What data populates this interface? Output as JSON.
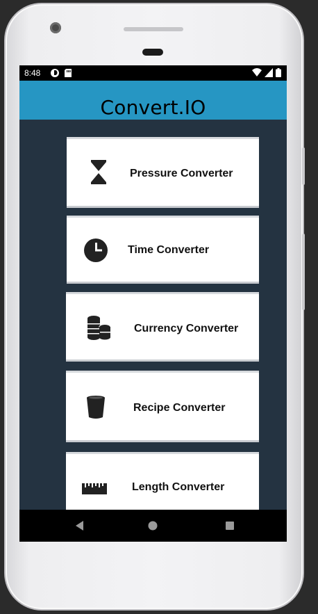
{
  "status_bar": {
    "time": "8:48"
  },
  "app": {
    "title": "Convert.IO"
  },
  "converters": [
    {
      "label": "Pressure Converter",
      "icon": "pressure-icon"
    },
    {
      "label": "Time Converter",
      "icon": "clock-icon"
    },
    {
      "label": "Currency Converter",
      "icon": "coins-icon"
    },
    {
      "label": "Recipe Converter",
      "icon": "cup-icon"
    },
    {
      "label": "Length Converter",
      "icon": "ruler-icon"
    }
  ],
  "nav": {
    "back": "back-icon",
    "home": "home-icon",
    "recents": "recents-icon"
  },
  "colors": {
    "app_bar": "#2696c3",
    "background": "#243341",
    "card": "#ffffff"
  }
}
